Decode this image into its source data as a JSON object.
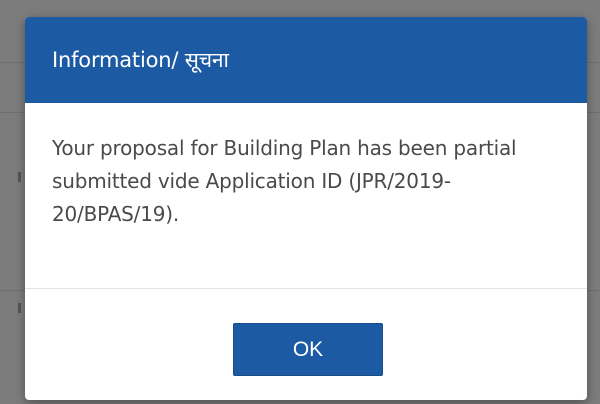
{
  "dialog": {
    "title": "Information/ सूचना",
    "message": "Your proposal for Building Plan has been partial submitted vide Application ID (JPR/2019-20/BPAS/19).",
    "ok_label": "OK"
  },
  "colors": {
    "header": "#1c5aa3",
    "button": "#1c5aa3",
    "overlay": "#7c7c7c",
    "body_text": "#4a4a4a"
  }
}
